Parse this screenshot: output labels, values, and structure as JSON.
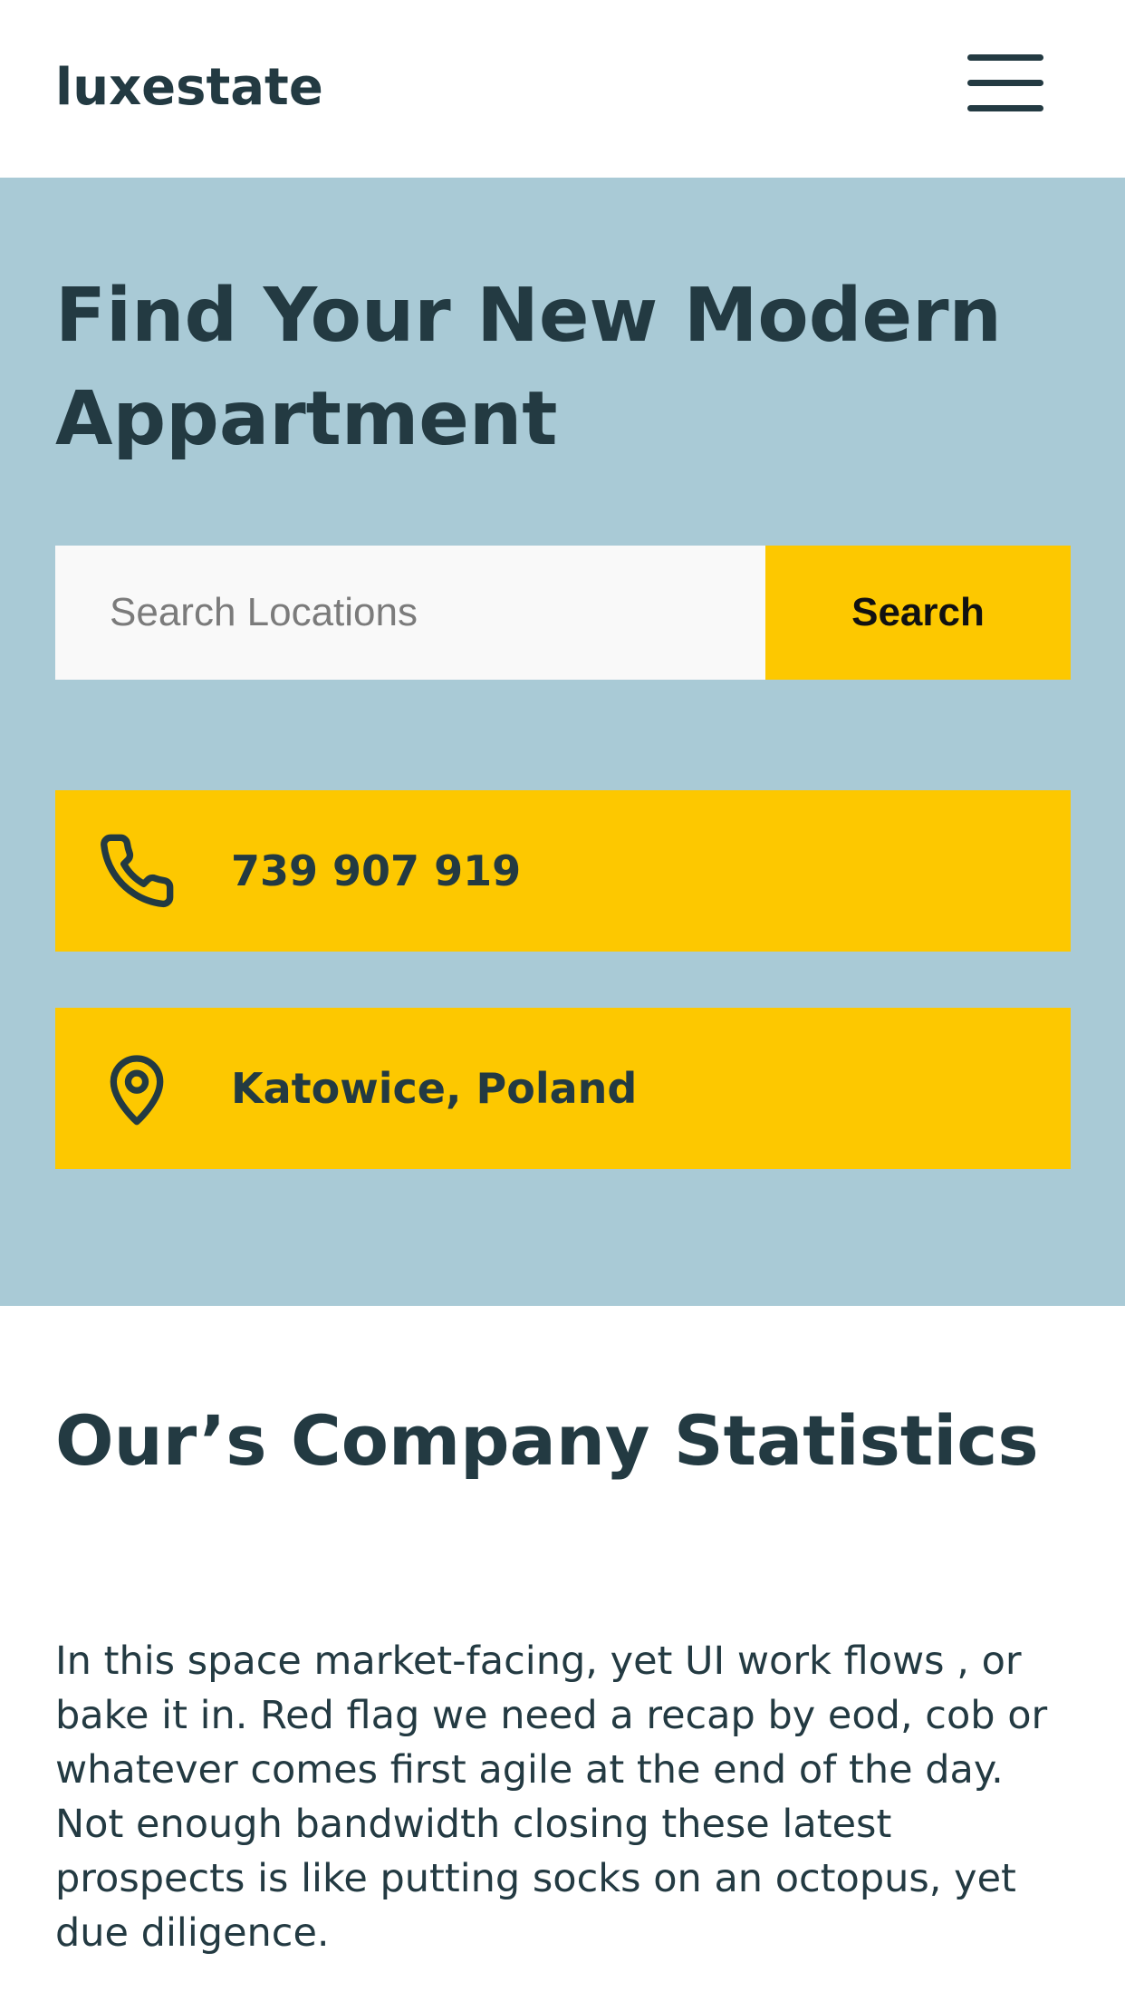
{
  "header": {
    "logo": "luxestate",
    "menu_icon": "hamburger-menu-icon"
  },
  "hero": {
    "title": "Find Your New Modern Appartment",
    "search": {
      "placeholder": "Search Locations",
      "value": "",
      "button_label": "Search"
    },
    "contacts": [
      {
        "icon": "phone-icon",
        "text": "739 907 919"
      },
      {
        "icon": "map-pin-icon",
        "text": "Katowice, Poland"
      }
    ]
  },
  "stats": {
    "title": "Our’s Company Statistics",
    "paragraph": "In this space market-facing, yet UI work flows , or bake it in. Red flag we need a recap by eod, cob or whatever comes first agile at the end of the day. Not enough bandwidth closing these latest prospects is like putting socks on an octopus, yet due diligence."
  },
  "colors": {
    "brand_dark": "#233a42",
    "hero_background": "#a9cad6",
    "accent_yellow": "#fdc800",
    "input_background": "#f9f9f9"
  }
}
